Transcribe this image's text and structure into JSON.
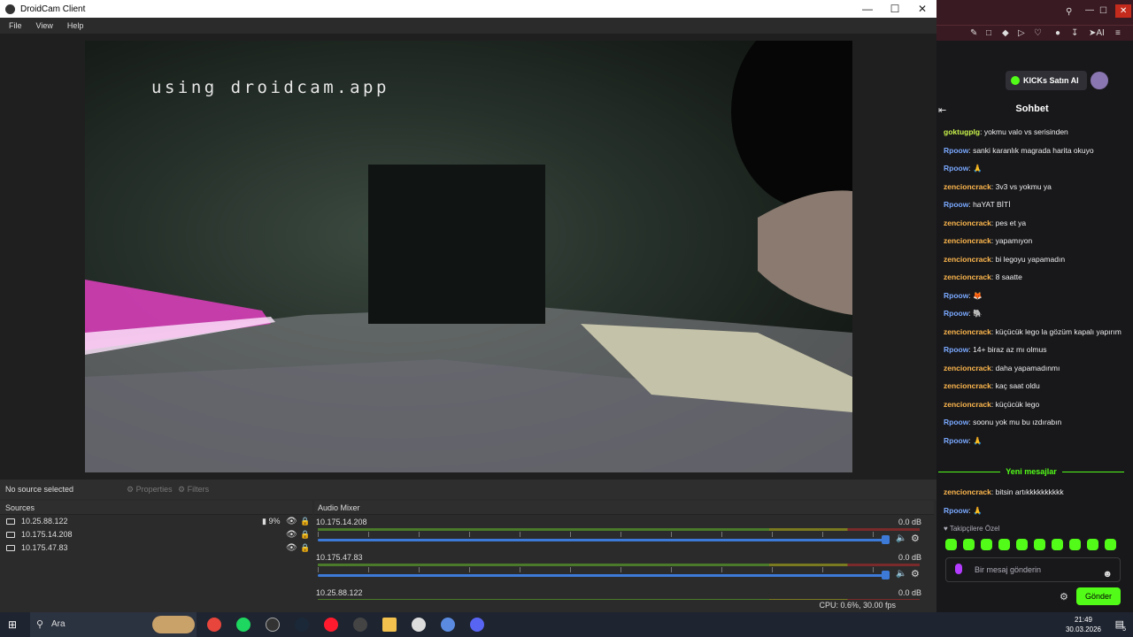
{
  "droidcam": {
    "title": "DroidCam Client",
    "menu": [
      "File",
      "View",
      "Help"
    ],
    "watermark": "using droidcam.app",
    "source_status": "No source selected",
    "properties_label": "Properties",
    "filters_label": "Filters",
    "sources_header": "Sources",
    "sources": [
      {
        "name": "10.25.88.122",
        "battery": "9%"
      },
      {
        "name": "10.175.14.208",
        "battery": ""
      },
      {
        "name": "10.175.47.83",
        "battery": ""
      }
    ],
    "mixer_header": "Audio Mixer",
    "channels": [
      {
        "name": "10.175.14.208",
        "db": "0.0 dB"
      },
      {
        "name": "10.175.47.83",
        "db": "0.0 dB"
      },
      {
        "name": "10.25.88.122",
        "db": "0.0 dB"
      }
    ],
    "status": "CPU: 0.6%, 30.00 fps",
    "accent": "#3d7ad8"
  },
  "kick": {
    "kicks_button": "KICKs Satın Al",
    "chat_title": "Sohbet",
    "messages": [
      {
        "user": "goktugplg",
        "text": "yokmu valo vs serisinden",
        "color": "#c9f24a"
      },
      {
        "user": "Rpoow",
        "text": "sanki karanlık magrada harita okuyo",
        "color": "#7aa9ff"
      },
      {
        "user": "Rpoow",
        "text": "🙏",
        "color": "#7aa9ff"
      },
      {
        "user": "zencioncrack",
        "text": "3v3 vs yokmu ya",
        "color": "#ffb84d"
      },
      {
        "user": "Rpoow",
        "text": "haYAT BİTİ",
        "color": "#7aa9ff"
      },
      {
        "user": "zencioncrack",
        "text": "pes et ya",
        "color": "#ffb84d"
      },
      {
        "user": "zencioncrack",
        "text": "yapamıyon",
        "color": "#ffb84d"
      },
      {
        "user": "zencioncrack",
        "text": "bi legoyu yapamadın",
        "color": "#ffb84d"
      },
      {
        "user": "zencioncrack",
        "text": "8 saatte",
        "color": "#ffb84d"
      },
      {
        "user": "Rpoow",
        "text": "🦊",
        "color": "#7aa9ff"
      },
      {
        "user": "Rpoow",
        "text": "🐘",
        "color": "#7aa9ff"
      },
      {
        "user": "zencioncrack",
        "text": "küçücük lego la gözüm kapalı yapırım",
        "color": "#ffb84d"
      },
      {
        "user": "Rpoow",
        "text": "14+ biraz az mı olmus",
        "color": "#7aa9ff"
      },
      {
        "user": "zencioncrack",
        "text": "daha yapamadınmı",
        "color": "#ffb84d"
      },
      {
        "user": "zencioncrack",
        "text": "kaç saat oldu",
        "color": "#ffb84d"
      },
      {
        "user": "zencioncrack",
        "text": "küçücük lego",
        "color": "#ffb84d"
      },
      {
        "user": "Rpoow",
        "text": "soonu yok mu bu ızdırabın",
        "color": "#7aa9ff"
      },
      {
        "user": "Rpoow",
        "text": "🙏",
        "color": "#7aa9ff"
      }
    ],
    "new_messages_label": "Yeni mesajlar",
    "new_messages": [
      {
        "user": "zencioncrack",
        "text": "bitsin artıkkkkkkkkkk",
        "color": "#ffb84d"
      },
      {
        "user": "Rpoow",
        "text": "🙏",
        "color": "#7aa9ff"
      }
    ],
    "subs_label": "Takipçilere Özel",
    "input_placeholder": "Bir mesaj gönderin",
    "send_label": "Gönder",
    "accent": "#53fc18"
  },
  "taskbar": {
    "search_label": "Ara",
    "time": "21:49",
    "date": "30.03.2026",
    "notifications": "5"
  }
}
